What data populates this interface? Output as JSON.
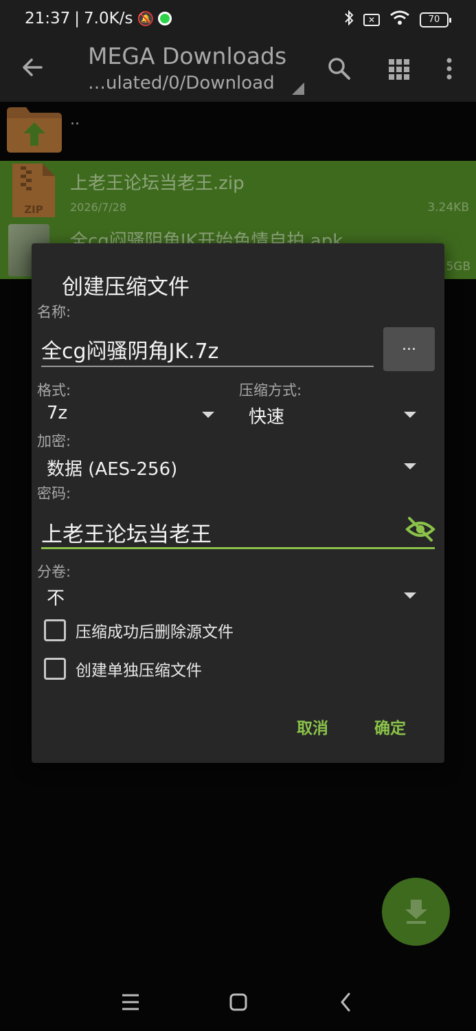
{
  "status_bar": {
    "time": "21:37",
    "speed": "7.0K/s",
    "battery": "70",
    "icons": [
      "mute-bell-icon",
      "app-dot-icon",
      "bluetooth-icon",
      "sim-x-icon",
      "wifi-icon",
      "battery-icon"
    ]
  },
  "app_bar": {
    "title": "MEGA Downloads",
    "path": "…ulated/0/Download"
  },
  "file_list": {
    "parent_label": "..",
    "files": [
      {
        "name": "上老王论坛当老王.zip",
        "date": "2026/7/28",
        "size": "3.24KB",
        "icon_label": "ZIP"
      },
      {
        "name": "全cg闷骚阴角JK开始色情自拍.apk",
        "size": "5GB"
      }
    ]
  },
  "dialog": {
    "title": "创建压缩文件",
    "name_label": "名称:",
    "name_value": "全cg闷骚阴角JK.7z",
    "dots_label": "...",
    "format_label": "格式:",
    "format_value": "7z",
    "method_label": "压缩方式:",
    "method_value": "快速",
    "encrypt_label": "加密:",
    "encrypt_value": "数据 (AES-256)",
    "password_label": "密码:",
    "password_value": "上老王论坛当老王",
    "volume_label": "分卷:",
    "volume_value": "不",
    "checkbox_delete": "压缩成功后删除源文件",
    "checkbox_separate": "创建单独压缩文件",
    "cancel": "取消",
    "confirm": "确定"
  },
  "colors": {
    "accent": "#8bc34a",
    "selection": "#3e6a1e",
    "dialog_bg": "#272727",
    "appbar_bg": "#1d1d1d"
  }
}
